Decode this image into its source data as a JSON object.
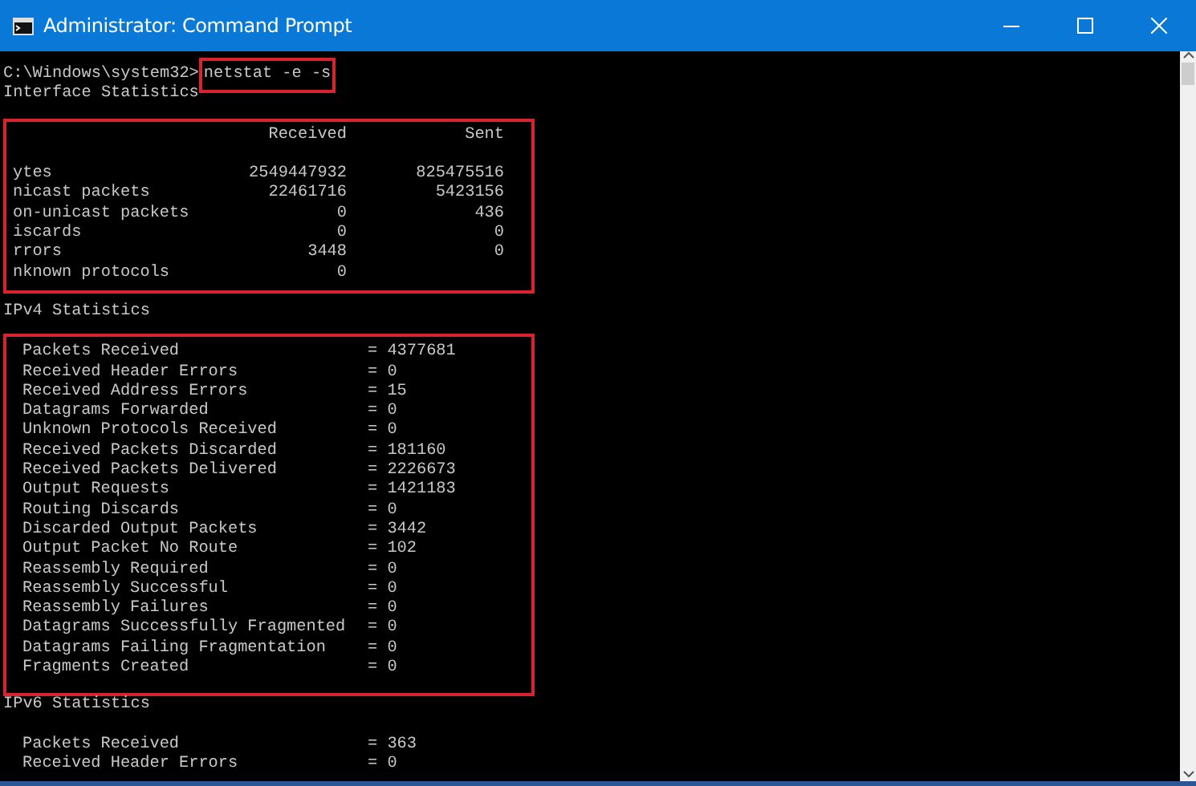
{
  "window": {
    "title": "Administrator: Command Prompt"
  },
  "console": {
    "prompt": "C:\\Windows\\system32>",
    "command": "netstat -e -s",
    "command_highlighted": true,
    "interface_statistics": {
      "title": "Interface Statistics",
      "highlighted": true,
      "columns": [
        "Received",
        "Sent"
      ],
      "rows": [
        {
          "label": "ytes",
          "received": "2549447932",
          "sent": "825475516"
        },
        {
          "label": "nicast packets",
          "received": "22461716",
          "sent": "5423156"
        },
        {
          "label": "on-unicast packets",
          "received": "0",
          "sent": "436"
        },
        {
          "label": "iscards",
          "received": "0",
          "sent": "0"
        },
        {
          "label": "rrors",
          "received": "3448",
          "sent": "0"
        },
        {
          "label": "nknown protocols",
          "received": "0"
        }
      ]
    },
    "ipv4_statistics": {
      "title": "IPv4 Statistics",
      "highlighted": true,
      "rows": [
        {
          "label": "Packets Received",
          "value": "= 4377681"
        },
        {
          "label": "Received Header Errors",
          "value": "= 0"
        },
        {
          "label": "Received Address Errors",
          "value": "= 15"
        },
        {
          "label": "Datagrams Forwarded",
          "value": "= 0"
        },
        {
          "label": "Unknown Protocols Received",
          "value": "= 0"
        },
        {
          "label": "Received Packets Discarded",
          "value": "= 181160"
        },
        {
          "label": "Received Packets Delivered",
          "value": "= 2226673"
        },
        {
          "label": "Output Requests",
          "value": "= 1421183"
        },
        {
          "label": "Routing Discards",
          "value": "= 0"
        },
        {
          "label": "Discarded Output Packets",
          "value": "= 3442"
        },
        {
          "label": "Output Packet No Route",
          "value": "= 102"
        },
        {
          "label": "Reassembly Required",
          "value": "= 0"
        },
        {
          "label": "Reassembly Successful",
          "value": "= 0"
        },
        {
          "label": "Reassembly Failures",
          "value": "= 0"
        },
        {
          "label": "Datagrams Successfully Fragmented",
          "value": "= 0"
        },
        {
          "label": "Datagrams Failing Fragmentation",
          "value": "= 0"
        },
        {
          "label": "Fragments Created",
          "value": "= 0"
        }
      ]
    },
    "ipv6_statistics": {
      "title": "IPv6 Statistics",
      "rows": [
        {
          "label": "Packets Received",
          "value": "= 363"
        },
        {
          "label": "Received Header Errors",
          "value": "= 0"
        }
      ]
    }
  }
}
